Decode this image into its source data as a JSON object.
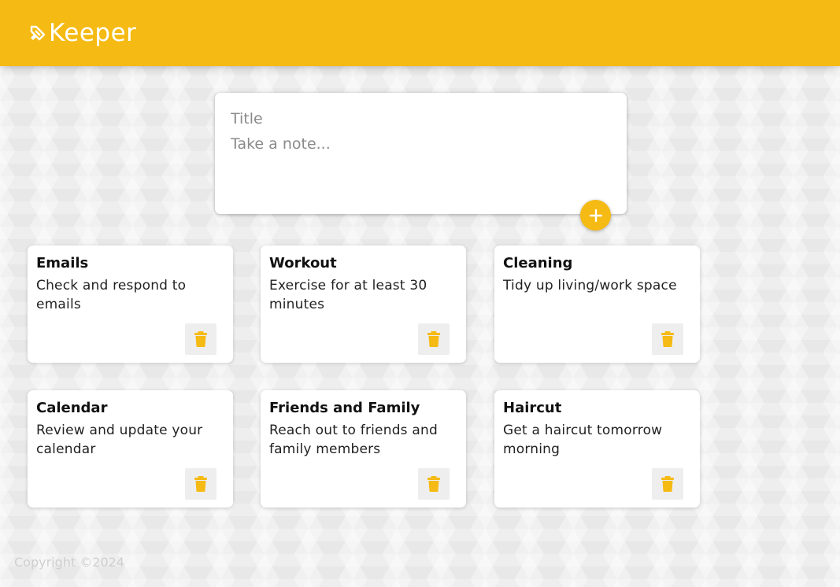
{
  "header": {
    "app_name": "Keeper",
    "logo_icon": "highlighter-icon",
    "brand_color": "#f5ba13"
  },
  "create_note": {
    "title_placeholder": "Title",
    "content_placeholder": "Take a note...",
    "add_icon": "plus-icon"
  },
  "notes": [
    {
      "title": "Emails",
      "content": "Check and respond to emails",
      "delete_icon": "trash-icon"
    },
    {
      "title": "Workout",
      "content": "Exercise for at least 30 minutes",
      "delete_icon": "trash-icon"
    },
    {
      "title": "Cleaning",
      "content": "Tidy up living/work space",
      "delete_icon": "trash-icon"
    },
    {
      "title": "Calendar",
      "content": "Review and update your calendar",
      "delete_icon": "trash-icon"
    },
    {
      "title": "Friends and Family",
      "content": "Reach out to friends and family members",
      "delete_icon": "trash-icon"
    },
    {
      "title": "Haircut",
      "content": "Get a haircut tomorrow morning",
      "delete_icon": "trash-icon"
    }
  ],
  "footer": {
    "copyright": "Copyright ©2024"
  }
}
